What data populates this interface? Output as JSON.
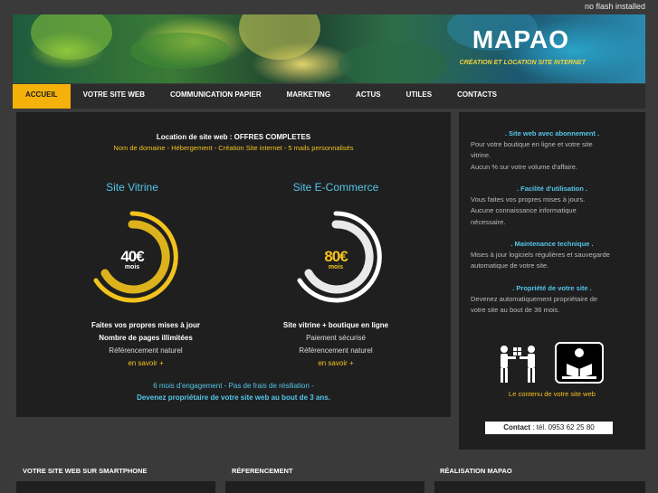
{
  "header": {
    "notice": "no flash installed",
    "title": "MAPAO",
    "subtitle": "CRÉATION ET LOCATION SITE INTERNET"
  },
  "nav": {
    "items": [
      {
        "label": "ACCUEIL",
        "active": true
      },
      {
        "label": "VOTRE SITE WEB",
        "active": false
      },
      {
        "label": "COMMUNICATION PAPIER",
        "active": false
      },
      {
        "label": "MARKETING",
        "active": false
      },
      {
        "label": "ACTUS",
        "active": false
      },
      {
        "label": "UTILES",
        "active": false
      },
      {
        "label": "CONTACTS",
        "active": false
      }
    ]
  },
  "offers": {
    "heading": "Location de site web : OFFRES COMPLETES",
    "subheading": "Nom de domaine - Hébergement - Création Site internet - 5 mails personnalisés",
    "plans": [
      {
        "title": "Site Vitrine",
        "price": "40€",
        "period": "mois",
        "ring_color": "#f2c31d",
        "features": [
          "Faites vos propres mises à jour",
          "Nombre de pages illimitées",
          "Référencement naturel"
        ],
        "more": "en savoir +"
      },
      {
        "title": "Site E-Commerce",
        "price": "80€",
        "period": "mois",
        "ring_color": "#ffffff",
        "features": [
          "Site vitrine + boutique en ligne",
          "Paiement sécurisé",
          "Référencement naturel"
        ],
        "more": "en savoir +"
      }
    ],
    "footer_line1": "6 mois d'engagement - Pas de frais de résiliation -",
    "footer_line2": "Devenez propriétaire de votre site web au bout de 3 ans."
  },
  "sidebar": {
    "blocks": [
      {
        "heading": ". Site web avec abonnement .",
        "lines": [
          "Pour votre boutique en ligne et votre site",
          "vitrine.",
          "Aucun % sur votre volume d'affaire."
        ]
      },
      {
        "heading": ". Facilité d'utilisation .",
        "lines": [
          "Vous faites vos propres mises à jours.",
          "Aucune connaissance informatique",
          "nécessaire."
        ]
      },
      {
        "heading": ". Maintenance technique .",
        "lines": [
          "Mises à jour logiciels régulières et sauvegarde",
          "automatique de votre site."
        ]
      },
      {
        "heading": ". Propriété de votre site .",
        "lines": [
          "Devenez automatiquement propriétaire de",
          "votre site au bout de 36 mois."
        ]
      }
    ],
    "caption": "Le contenu de votre site web",
    "contact_label": "Contact",
    "contact_text": " : tél. 0953 62 25 80"
  },
  "footer": {
    "headings": [
      "VOTRE SITE WEB SUR SMARTPHONE",
      "RÉFERENCEMENT",
      "RÉALISATION MAPAO"
    ]
  },
  "colors": {
    "accent": "#f3b10a",
    "link": "#55c5ea",
    "highlight": "#f2c31d"
  }
}
